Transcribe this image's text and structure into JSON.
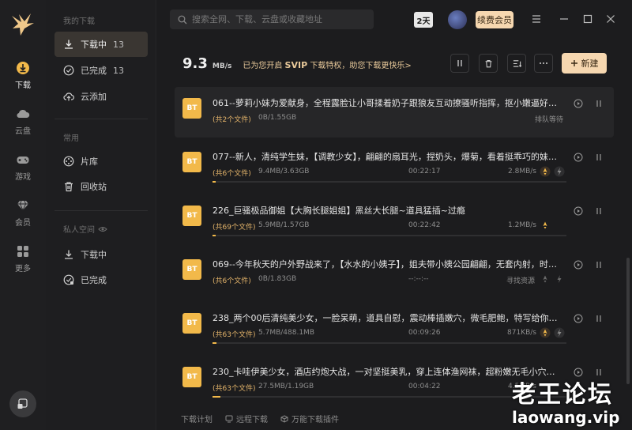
{
  "rail": {
    "items": [
      {
        "label": "下载",
        "icon": "download-circle-icon"
      },
      {
        "label": "云盘",
        "icon": "cloud-icon"
      },
      {
        "label": "游戏",
        "icon": "gamepad-icon"
      },
      {
        "label": "会员",
        "icon": "diamond-icon"
      },
      {
        "label": "更多",
        "icon": "grid-icon"
      }
    ]
  },
  "nav": {
    "section_mine": "我的下载",
    "downloading": {
      "label": "下载中",
      "count": "13"
    },
    "completed": {
      "label": "已完成",
      "count": "13"
    },
    "cloud_add": {
      "label": "云添加"
    },
    "section_common": "常用",
    "library": {
      "label": "片库"
    },
    "recycle": {
      "label": "回收站"
    },
    "section_private": "私人空间",
    "private_downloading": {
      "label": "下载中"
    },
    "private_completed": {
      "label": "已完成"
    }
  },
  "header": {
    "search_placeholder": "搜索全网、下载、云盘或收藏地址",
    "days_badge": "2天",
    "vip_button": "续费会员"
  },
  "toolbar": {
    "speed_value": "9.3",
    "speed_unit": "MB/s",
    "svip_prefix": "已为您开启",
    "svip_brand": "SVIP",
    "svip_suffix": "下载特权，助您下载更快乐>",
    "new_button": "新建"
  },
  "tasks": [
    {
      "title": "061--萝莉小妹为爱献身，全程露脸让小哥揉着奶子跟狼友互动撩骚听指挥，抠小嫩逼好多淫水…",
      "files": "(共2个文件)",
      "size": "0B/1.55GB",
      "eta": "",
      "rate": "",
      "status": "排队等待",
      "progress": 0
    },
    {
      "title": "077--新人，清纯学生妹，【调教少女】，翩翩的扇耳光，捏奶头，爆菊，看着挺乖巧的妹子，…",
      "files": "(共6个文件)",
      "size": "9.4MB/3.63GB",
      "eta": "00:22:17",
      "rate": "2.8MB/s",
      "status": "",
      "progress": 0.003
    },
    {
      "title": "226_巨骚极品御姐【大胸长腿姐姐】黑丝大长腿~道具猛插~过瘾",
      "files": "(共69个文件)",
      "size": "5.9MB/1.57GB",
      "eta": "00:22:42",
      "rate": "1.2MB/s",
      "status": "",
      "progress": 0.004
    },
    {
      "title": "069--今年秋天的户外野战来了，【水水的小姨子】，姐夫带小姨公园翩翩，无套内射，时刻担…",
      "files": "(共6个文件)",
      "size": "0B/1.83GB",
      "eta": "--:--:--",
      "rate": "",
      "status": "寻找资源",
      "progress": 0
    },
    {
      "title": "238_两个00后清纯美少女，一脸呆萌，道具自慰，震动棒插嫩穴，微毛肥鲍，特写给你，慢慢…",
      "files": "(共63个文件)",
      "size": "5.7MB/488.1MB",
      "eta": "00:09:26",
      "rate": "871KB/s",
      "status": "",
      "progress": 0.012
    },
    {
      "title": "230_卡哇伊美少女，酒店约炮大战，一对坚挺美乳，穿上连体渔网袜，超粉嫩无毛小穴，骑乘…",
      "files": "(共63个文件)",
      "size": "27.5MB/1.19GB",
      "eta": "00:04:22",
      "rate": "4.5MB/s",
      "status": "",
      "progress": 0.023
    }
  ],
  "footer": {
    "plan": "下载计划",
    "remote": "远程下载",
    "plugins": "万能下载插件"
  },
  "watermark": {
    "cn": "老王论坛",
    "en": "laowang.vip"
  },
  "colors": {
    "accent": "#f6d7b0",
    "bt_icon": "#f2b94a",
    "files_text": "#e4b46a",
    "svip_text": "#e8c99a"
  }
}
